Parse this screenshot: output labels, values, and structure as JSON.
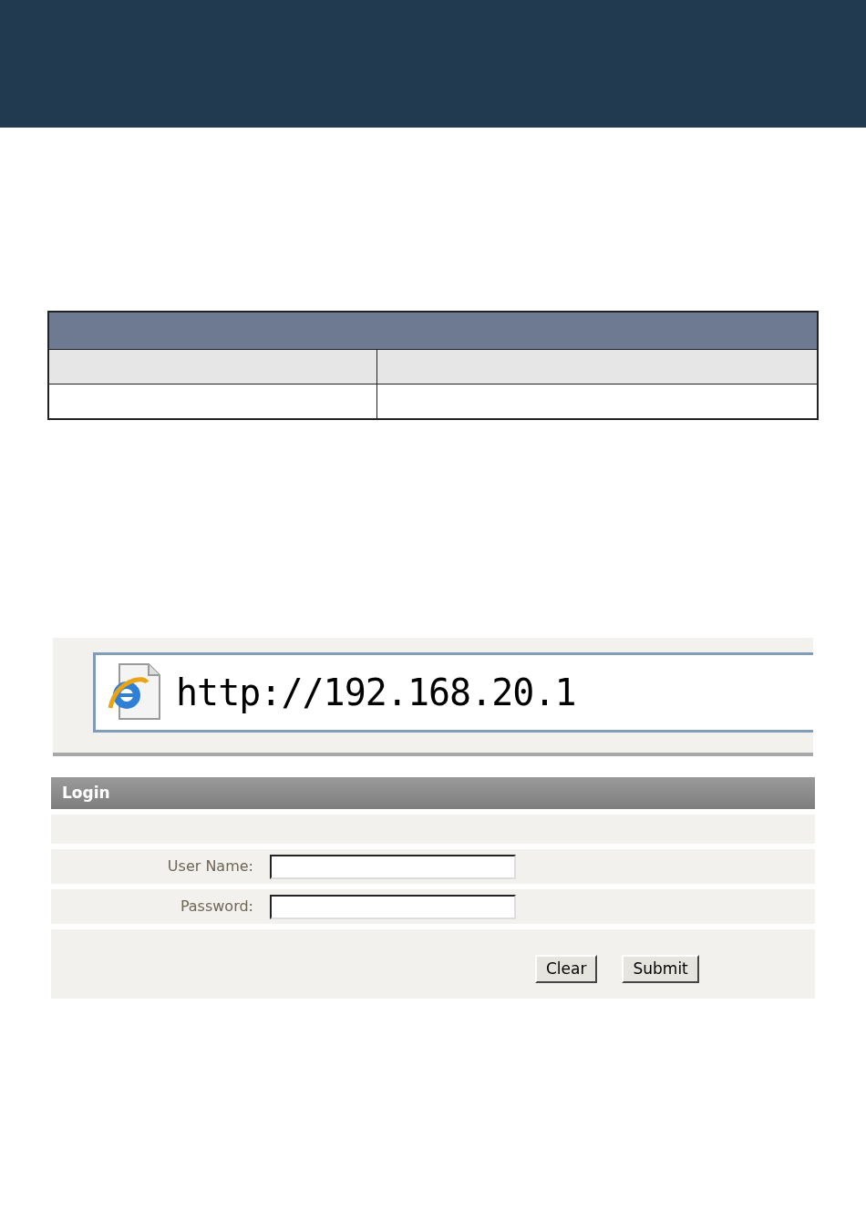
{
  "address_bar": {
    "url": "http://192.168.20.1"
  },
  "login": {
    "title": "Login",
    "fields": [
      {
        "label": "User Name:"
      },
      {
        "label": "Password:"
      }
    ],
    "buttons": [
      "Clear",
      "Submit"
    ]
  }
}
